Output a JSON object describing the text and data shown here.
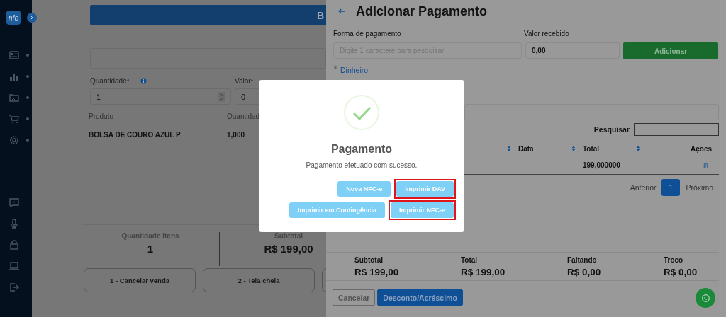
{
  "sidebar": {
    "logo": "nfe"
  },
  "sale": {
    "top_button": "B",
    "quantity_label": "Quantidade*",
    "quantity_value": "1",
    "value_label": "Valor*",
    "value_value": "0",
    "table": {
      "columns": [
        "Produto",
        "Quantidad"
      ],
      "rows": [
        [
          "BOLSA DE COURO AZUL P",
          "1,000"
        ]
      ]
    },
    "summary": [
      {
        "label": "Quantidade Itens",
        "value": "1"
      },
      {
        "label": "Subtotal",
        "value": "R$ 199,00"
      }
    ],
    "actions": [
      {
        "hotkey": "1",
        "label": " - Cancelar venda"
      },
      {
        "hotkey": "2",
        "label": " - Tela cheia"
      }
    ]
  },
  "payment_panel": {
    "title": "Adicionar Pagamento",
    "method_label": "Forma de pagamento",
    "method_placeholder": "Digite 1 caractere para pesquisar",
    "received_label": "Valor recebido",
    "received_value": "0,00",
    "add_button": "Adicionar",
    "selected_method": "Dinheiro",
    "search_label": "Pesquisar",
    "table": {
      "columns": [
        "Data",
        "Total",
        "Ações"
      ],
      "rows": [
        {
          "total": "199,000000"
        }
      ]
    },
    "pagination": {
      "previous": "Anterior",
      "pages": [
        {
          "label": "1",
          "selected": true
        }
      ],
      "next": "Próximo"
    },
    "totals": [
      {
        "label": "Subtotal",
        "value": "R$ 199,00"
      },
      {
        "label": "Total",
        "value": "R$ 199,00"
      },
      {
        "label": "Faltando",
        "value": "R$ 0,00"
      },
      {
        "label": "Troco",
        "value": "R$ 0,00"
      }
    ],
    "buttons": [
      {
        "label": "Cancelar",
        "kind": "outline"
      },
      {
        "label": "Desconto/Acréscimo",
        "kind": "primary"
      }
    ]
  },
  "modal": {
    "title": "Pagamento",
    "message": "Pagamento efetuado com sucesso.",
    "button_rows": [
      [
        {
          "label": "Nova NFC-e",
          "highlighted": false
        },
        {
          "label": "Imprimir DAV",
          "highlighted": true
        }
      ],
      [
        {
          "label": "Imprimir em Contingência",
          "highlighted": false
        },
        {
          "label": "Imprimir NFC-e",
          "highlighted": true
        }
      ]
    ]
  }
}
